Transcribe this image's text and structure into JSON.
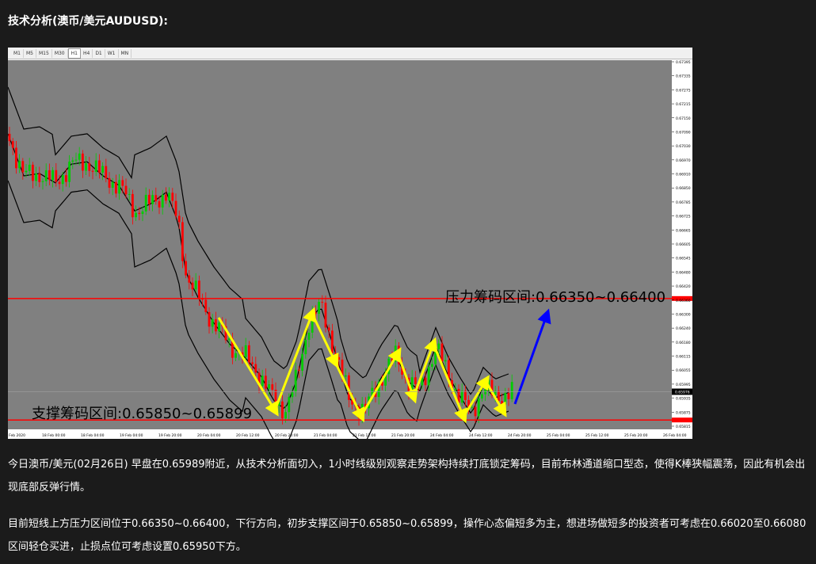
{
  "heading": "技术分析(澳币/美元AUDUSD):",
  "toolbar": {
    "timeframes": [
      "M1",
      "M5",
      "M15",
      "M30",
      "H1",
      "H4",
      "D1",
      "W1",
      "MN"
    ],
    "active": "H1"
  },
  "chart_data": {
    "type": "candlestick",
    "resistance_label": "压力筹码区间:0.66350~0.66400",
    "support_label": "支撑筹码区间:0.65850~0.65899",
    "resistance_level": 0.66375,
    "support_level": 0.65855,
    "current_price": 0.65976,
    "current_price_label": "0.65976",
    "ylim": [
      0.65815,
      0.67395
    ],
    "y_ticks": [
      "0.67395",
      "0.67335",
      "0.67275",
      "0.67215",
      "0.67150",
      "0.67090",
      "0.67030",
      "0.66970",
      "0.66910",
      "0.66850",
      "0.66785",
      "0.66725",
      "0.66665",
      "0.66605",
      "0.66545",
      "0.66480",
      "0.66420",
      "0.66360",
      "0.66300",
      "0.66240",
      "0.66180",
      "0.66115",
      "0.66055",
      "0.65995",
      "0.65935",
      "0.65875",
      "0.65815"
    ],
    "x_ticks": [
      "16 Feb 2020",
      "18 Feb 00:00",
      "18 Feb 04:00",
      "19 Feb 04:00",
      "19 Feb 20:00",
      "20 Feb 04:00",
      "20 Feb 12:00",
      "20 Feb 20:00",
      "21 Feb 04:00",
      "21 Feb 12:00",
      "21 Feb 20:00",
      "24 Feb 04:00",
      "24 Feb 12:00",
      "24 Feb 20:00",
      "25 Feb 04:00",
      "25 Feb 12:00",
      "25 Feb 20:00",
      "26 Feb 04:00"
    ],
    "up_color": "#00cc00",
    "down_color": "#ff0000",
    "band_color": "#000000",
    "arrow_color_yellow": "#ffff00",
    "arrow_color_blue": "#0000ff",
    "level_color": "#ff0000",
    "background": "#808080"
  },
  "paragraph1": "今日澳币/美元(02月26日) 早盘在0.65989附近，从技术分析面切入，1小时线级别观察走势架构持续打底锁定筹码，目前布林通道缩口型态，使得K棒狭幅震荡，因此有机会出现底部反弹行情。",
  "paragraph2": "目前短线上方压力区间位于0.66350~0.66400，下行方向，初步支撑区间于0.65850~0.65899，操作心态偏短多为主，想进场做短多的投资者可考虑在0.66020至0.66080区间轻仓买进，止损点位可考虑设置0.65950下方。"
}
